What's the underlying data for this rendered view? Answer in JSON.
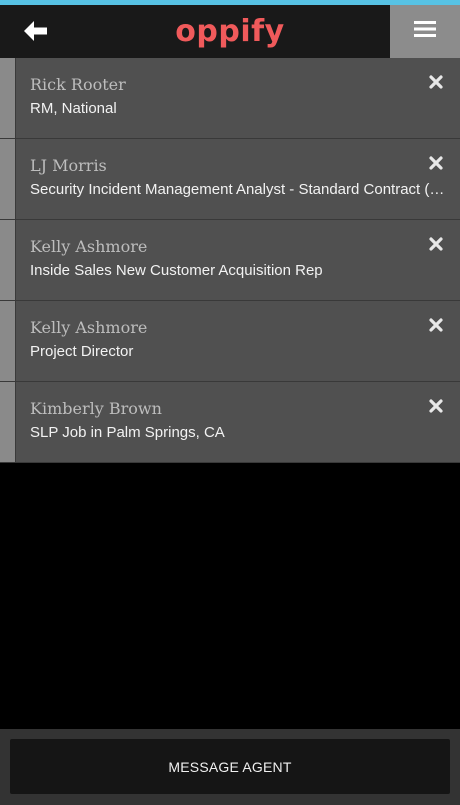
{
  "colors": {
    "accent_bar": "#57c2e4",
    "brand": "#f05a5b",
    "menu_bg": "#8c8c8c"
  },
  "header": {
    "logo_text": "oppify",
    "back_icon": "back-arrow-icon",
    "menu_icon": "hamburger-menu-icon"
  },
  "items": [
    {
      "name": "Rick Rooter",
      "title": "RM, National"
    },
    {
      "name": "LJ Morris",
      "title": "Security Incident Management Analyst - Standard Contract (C…"
    },
    {
      "name": "Kelly Ashmore",
      "title": "Inside Sales New Customer Acquisition Rep"
    },
    {
      "name": "Kelly Ashmore",
      "title": "Project Director"
    },
    {
      "name": "Kimberly Brown",
      "title": "SLP Job in Palm Springs, CA"
    }
  ],
  "footer": {
    "message_button_label": "MESSAGE AGENT"
  }
}
